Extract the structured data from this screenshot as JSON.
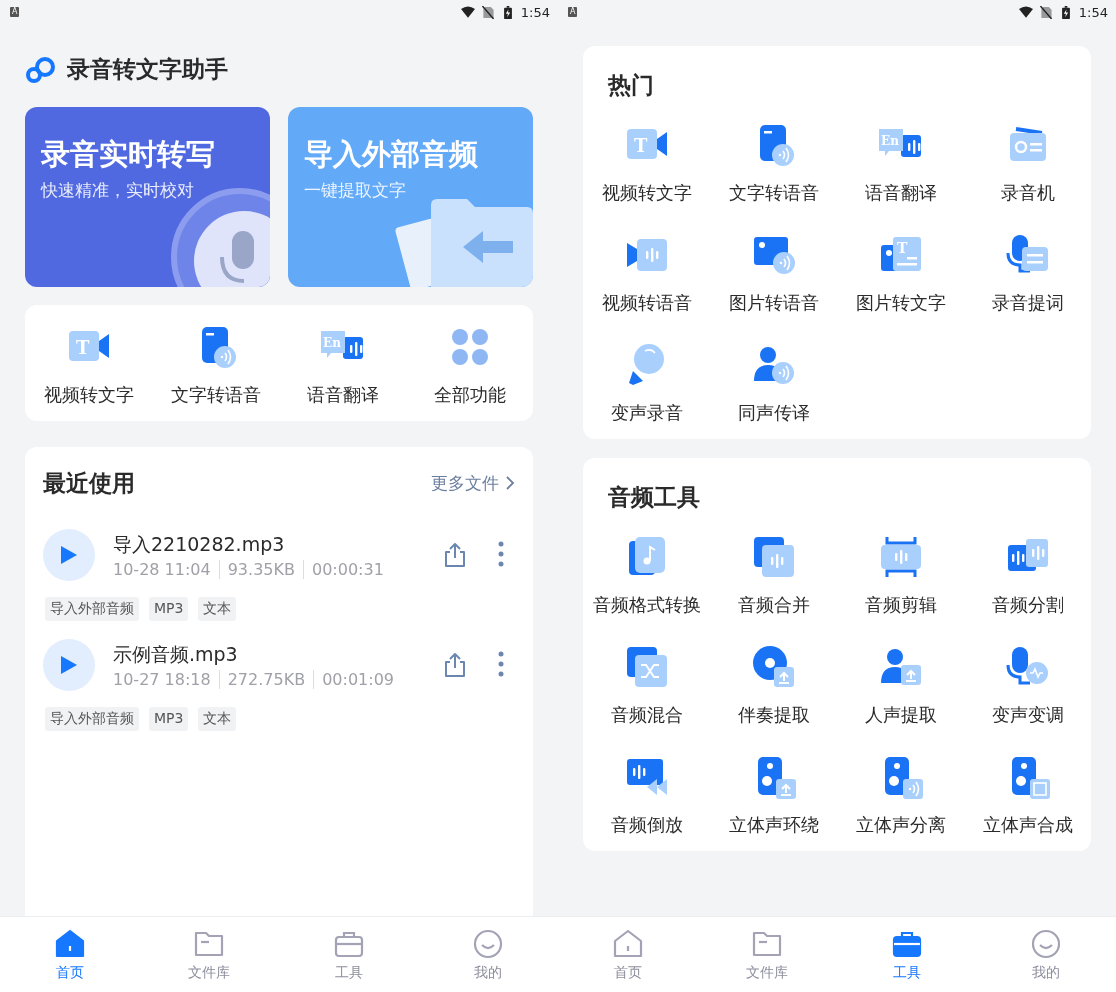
{
  "home": {
    "status_bar": {
      "notice": "A",
      "time": "1:54"
    },
    "app_title": "录音转文字助手",
    "banners": [
      {
        "title": "录音实时转写",
        "subtitle": "快速精准，实时校对"
      },
      {
        "title": "导入外部音频",
        "subtitle": "一键提取文字"
      }
    ],
    "shortcuts": [
      {
        "label": "视频转文字",
        "badge": "T"
      },
      {
        "label": "文字转语音"
      },
      {
        "label": "语音翻译",
        "badge": "En"
      },
      {
        "label": "全部功能"
      }
    ],
    "recent": {
      "title": "最近使用",
      "more": "更多文件",
      "files": [
        {
          "name": "导入2210282.mp3",
          "date": "10-28 11:04",
          "size": "93.35KB",
          "duration": "00:00:31",
          "tags": [
            "导入外部音频",
            "MP3",
            "文本"
          ]
        },
        {
          "name": "示例音频.mp3",
          "date": "10-27 18:18",
          "size": "272.75KB",
          "duration": "00:01:09",
          "tags": [
            "导入外部音频",
            "MP3",
            "文本"
          ]
        }
      ]
    },
    "nav": [
      {
        "label": "首页",
        "selected": true
      },
      {
        "label": "文件库",
        "selected": false
      },
      {
        "label": "工具",
        "selected": false
      },
      {
        "label": "我的",
        "selected": false
      }
    ]
  },
  "tools": {
    "status_bar": {
      "notice": "A",
      "time": "1:54"
    },
    "sections": [
      {
        "title": "热门",
        "items": [
          {
            "label": "视频转文字",
            "badge": "T"
          },
          {
            "label": "文字转语音"
          },
          {
            "label": "语音翻译",
            "badge": "En"
          },
          {
            "label": "录音机"
          },
          {
            "label": "视频转语音"
          },
          {
            "label": "图片转语音"
          },
          {
            "label": "图片转文字",
            "badge": "T"
          },
          {
            "label": "录音提词"
          },
          {
            "label": "变声录音"
          },
          {
            "label": "同声传译"
          }
        ]
      },
      {
        "title": "音频工具",
        "items": [
          {
            "label": "音频格式转换"
          },
          {
            "label": "音频合并"
          },
          {
            "label": "音频剪辑"
          },
          {
            "label": "音频分割"
          },
          {
            "label": "音频混合"
          },
          {
            "label": "伴奏提取"
          },
          {
            "label": "人声提取"
          },
          {
            "label": "变声变调"
          },
          {
            "label": "音频倒放"
          },
          {
            "label": "立体声环绕"
          },
          {
            "label": "立体声分离"
          },
          {
            "label": "立体声合成"
          }
        ]
      }
    ],
    "nav": [
      {
        "label": "首页",
        "selected": false
      },
      {
        "label": "文件库",
        "selected": false
      },
      {
        "label": "工具",
        "selected": true
      },
      {
        "label": "我的",
        "selected": false
      }
    ]
  }
}
